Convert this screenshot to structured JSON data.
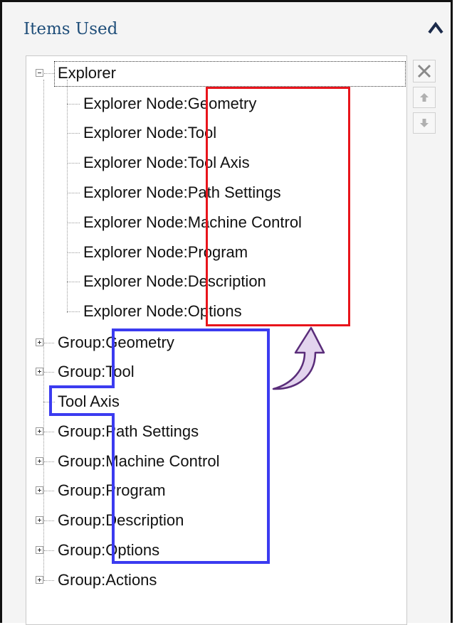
{
  "panel": {
    "title": "Items Used"
  },
  "side_buttons": {
    "remove": "remove",
    "move_up": "move up",
    "move_down": "move down"
  },
  "tree": {
    "explorer": {
      "label": "Explorer",
      "children": [
        {
          "prefix": "Explorer Node:",
          "name": "Geometry"
        },
        {
          "prefix": "Explorer Node:",
          "name": "Tool"
        },
        {
          "prefix": "Explorer Node:",
          "name": "Tool Axis"
        },
        {
          "prefix": "Explorer Node:",
          "name": "Path Settings"
        },
        {
          "prefix": "Explorer Node:",
          "name": "Machine Control"
        },
        {
          "prefix": "Explorer Node:",
          "name": "Program"
        },
        {
          "prefix": "Explorer Node:",
          "name": "Description"
        },
        {
          "prefix": "Explorer Node:",
          "name": "Options"
        }
      ]
    },
    "groups": [
      {
        "prefix": "Group:",
        "name": "Geometry"
      },
      {
        "prefix": "Group:",
        "name": "Tool"
      },
      {
        "prefix": "",
        "name": "Tool Axis"
      },
      {
        "prefix": "Group:",
        "name": "Path Settings"
      },
      {
        "prefix": "Group:",
        "name": "Machine Control"
      },
      {
        "prefix": "Group:",
        "name": "Program"
      },
      {
        "prefix": "Group:",
        "name": "Description"
      },
      {
        "prefix": "Group:",
        "name": "Options"
      },
      {
        "prefix": "Group:",
        "name": "Actions"
      }
    ]
  },
  "colors": {
    "title": "#1f4e79",
    "red_highlight": "#e8141b",
    "blue_highlight": "#3b3bf0",
    "arrow_fill": "#e3d4ee",
    "arrow_stroke": "#5a2d7a"
  }
}
